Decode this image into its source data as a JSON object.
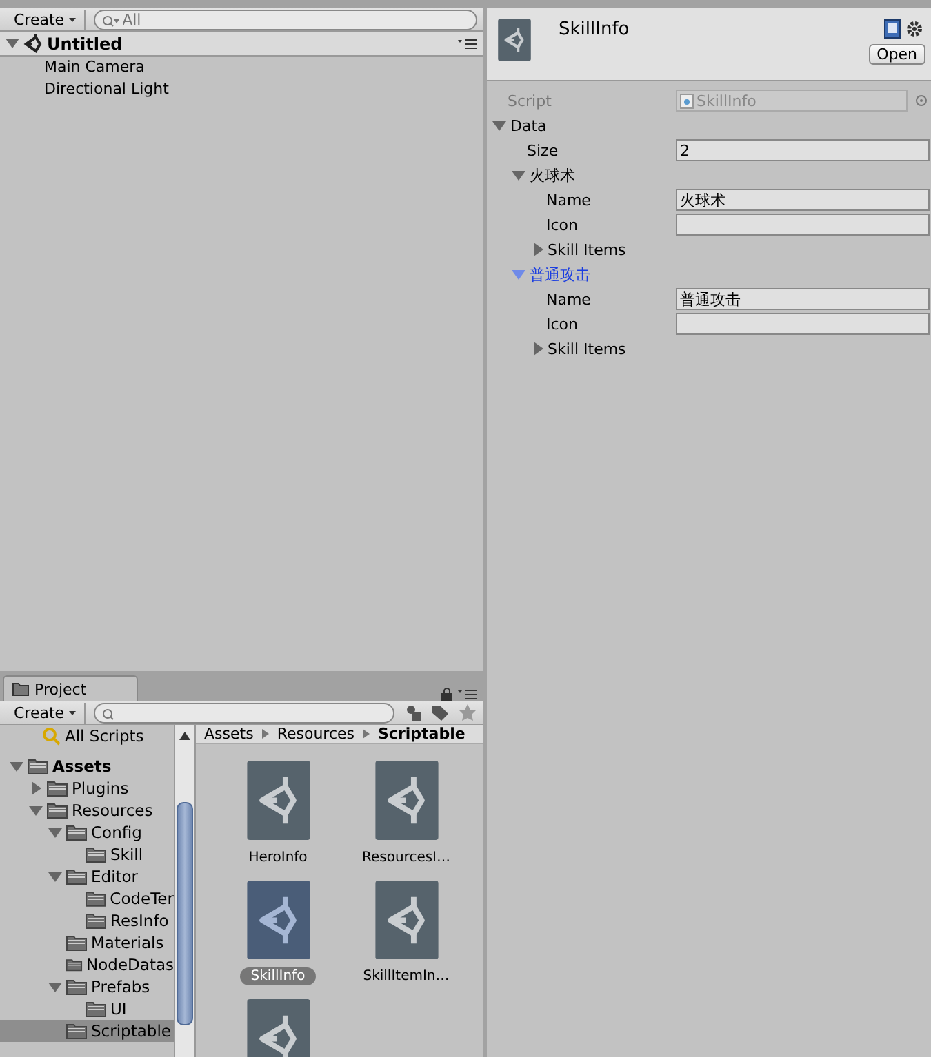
{
  "hierarchy": {
    "create_button": "Create",
    "search": {
      "placeholder": "All"
    },
    "scene": {
      "title": "Untitled",
      "expanded": true
    },
    "items": [
      {
        "label": "Main Camera",
        "selected": false
      },
      {
        "label": "Directional Light",
        "selected": false
      }
    ]
  },
  "project": {
    "tab": "Project",
    "create_button": "Create",
    "favorites": [
      {
        "label": "All Scripts",
        "selected": false
      }
    ],
    "tree": [
      {
        "label": "Assets",
        "expanded": true,
        "selected": false,
        "children": [
          {
            "label": "Plugins",
            "expanded": false,
            "selected": false
          },
          {
            "label": "Resources",
            "expanded": true,
            "selected": false,
            "children": [
              {
                "label": "Config",
                "expanded": true,
                "selected": false,
                "children": [
                  {
                    "label": "Skill",
                    "selected": false
                  }
                ]
              },
              {
                "label": "Editor",
                "expanded": true,
                "selected": false,
                "children": [
                  {
                    "label": "CodeTer",
                    "selected": false
                  },
                  {
                    "label": "ResInfo",
                    "selected": false
                  }
                ]
              },
              {
                "label": "Materials",
                "selected": false
              },
              {
                "label": "NodeDatas",
                "selected": false
              },
              {
                "label": "Prefabs",
                "expanded": true,
                "selected": false,
                "children": [
                  {
                    "label": "UI",
                    "selected": false
                  }
                ]
              },
              {
                "label": "Scriptable",
                "selected": true
              }
            ]
          }
        ]
      }
    ],
    "breadcrumb": [
      "Assets",
      "Resources",
      "Scriptable"
    ],
    "assets": [
      {
        "label": "HeroInfo",
        "selected": false
      },
      {
        "label": "ResourcesI…",
        "selected": false
      },
      {
        "label": "SkillInfo",
        "selected": true
      },
      {
        "label": "SkillItemIn…",
        "selected": false
      },
      {
        "selected": false
      }
    ]
  },
  "inspector": {
    "title": "SkillInfo",
    "open_button": "Open",
    "rows": [
      {
        "kind": "field",
        "label": "Script",
        "value": "SkillInfo",
        "disabled": true
      },
      {
        "kind": "foldout",
        "label": "Data",
        "expanded": true,
        "selected": false,
        "children": [
          {
            "kind": "field",
            "label": "Size",
            "value": "2",
            "disabled": false
          },
          {
            "kind": "foldout",
            "label": "火球术",
            "expanded": true,
            "selected": false,
            "children": [
              {
                "kind": "field",
                "label": "Name",
                "value": "火球术",
                "disabled": false
              },
              {
                "kind": "field",
                "label": "Icon",
                "disabled": false
              },
              {
                "kind": "foldout",
                "label": "Skill Items",
                "expanded": false,
                "selected": false
              }
            ]
          },
          {
            "kind": "foldout",
            "label": "普通攻击",
            "expanded": true,
            "selected": true,
            "children": [
              {
                "kind": "field",
                "label": "Name",
                "value": "普通攻击",
                "disabled": false
              },
              {
                "kind": "field",
                "label": "Icon",
                "disabled": false
              },
              {
                "kind": "foldout",
                "label": "Skill Items",
                "expanded": false,
                "selected": false
              }
            ]
          }
        ]
      }
    ]
  }
}
